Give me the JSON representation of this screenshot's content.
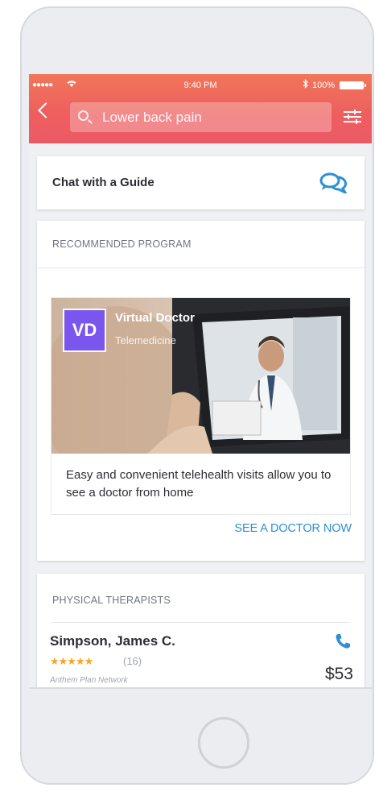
{
  "status_bar": {
    "signal": "●●●●●",
    "time": "9:40 PM",
    "battery": "100%"
  },
  "header": {
    "search_value": "Lower back pain"
  },
  "chat": {
    "label": "Chat with a Guide",
    "icon": "chat-bubbles-icon"
  },
  "recommended": {
    "section_title": "RECOMMENDED PROGRAM",
    "badge": "VD",
    "name": "Virtual Doctor",
    "type": "Telemedicine",
    "description": "Easy and convenient telehealth visits allow you to see a doctor from home",
    "cta": "SEE A DOCTOR NOW"
  },
  "therapists": {
    "section_title": "PHYSICAL THERAPISTS",
    "items": [
      {
        "name": "Simpson, James C.",
        "stars": "★★★★★",
        "rating_count": "(16)",
        "network": "Anthem Plan Network",
        "price": "$53"
      }
    ]
  },
  "colors": {
    "header_start": "#f0765a",
    "header_end": "#ec5a66",
    "accent_blue": "#2d8fd6",
    "badge_purple": "#7a55ee",
    "star": "#f5a623"
  }
}
